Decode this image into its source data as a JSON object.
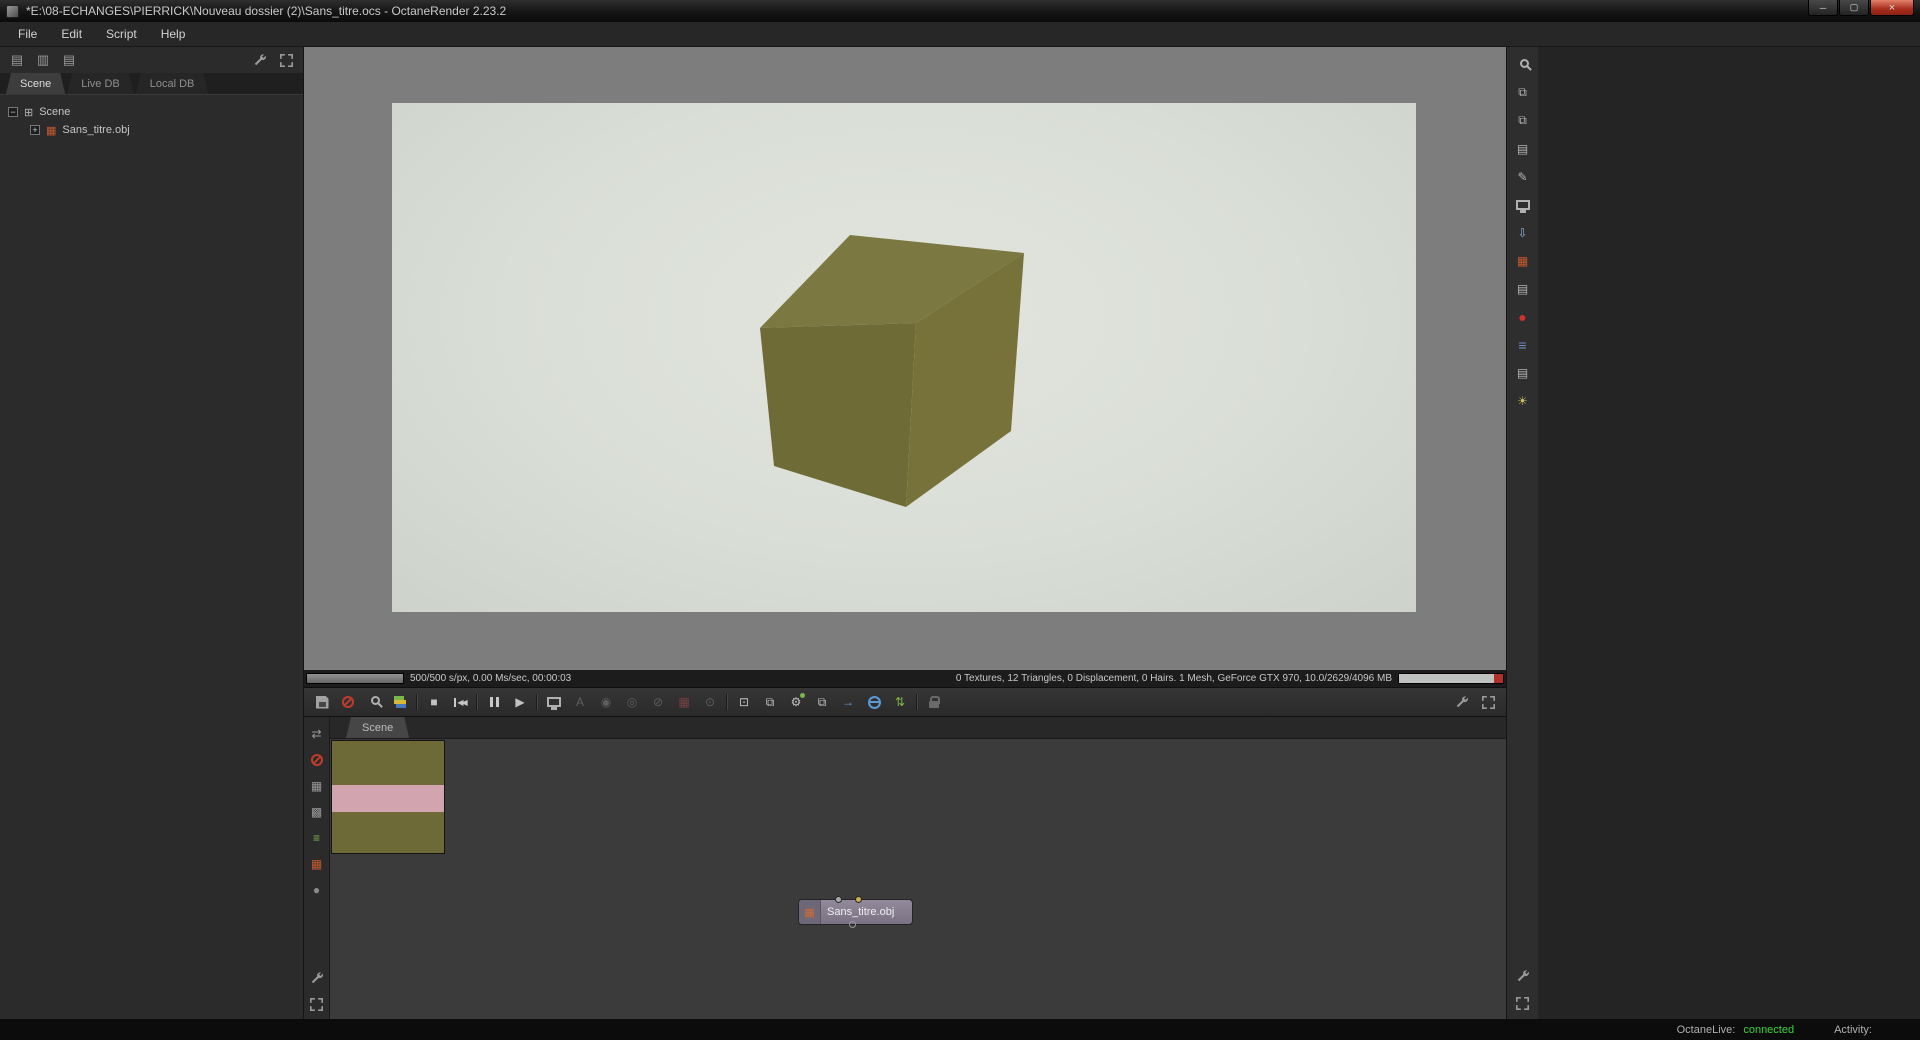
{
  "window": {
    "title": "*E:\\08-ECHANGES\\PIERRICK\\Nouveau dossier (2)\\Sans_titre.ocs - OctaneRender 2.23.2"
  },
  "menu": {
    "items": [
      {
        "label": "File"
      },
      {
        "label": "Edit"
      },
      {
        "label": "Script"
      },
      {
        "label": "Help"
      }
    ]
  },
  "outliner": {
    "tabs": [
      {
        "label": "Scene",
        "active": true
      },
      {
        "label": "Live DB",
        "active": false
      },
      {
        "label": "Local DB",
        "active": false
      }
    ],
    "tree": [
      {
        "label": "Scene",
        "toggle": "−"
      },
      {
        "label": "Sans_titre.obj",
        "toggle": "+"
      }
    ]
  },
  "render_status": {
    "progress_text": "500/500 s/px, 0.00 Ms/sec, 00:00:03",
    "stats_text": "0 Textures, 12 Triangles, 0 Displacement, 0 Hairs. 1 Mesh, GeForce GTX 970, 10.0/2629/4096 MB"
  },
  "nodegraph": {
    "tab_label": "Scene",
    "node_label": "Sans_titre.obj",
    "node_pins": [
      {
        "color": "#a8a8a8"
      },
      {
        "color": "#c8b050"
      },
      {
        "color": "outline"
      }
    ]
  },
  "statusbar": {
    "live_label": "OctaneLive:",
    "live_value": "connected",
    "live_style": "color:#35d435",
    "activity_label": "Activity:"
  },
  "colors": {
    "cube_top": "#7c7841",
    "cube_left": "#6f6b37",
    "cube_right": "#767239",
    "render_bg": "#dce0d8",
    "preview_olive": "#6e6a38",
    "preview_pink": "#d2a4b0",
    "node_body": "#8b8290",
    "accent_red": "#c23b2e",
    "connected_green": "#35d435"
  },
  "glyphs": {
    "minimize": "─",
    "maximize": "▢",
    "close": "×",
    "panel_a": "▤",
    "panel_b": "▥",
    "panel_c": "▤",
    "scene_node": "⊞",
    "mesh": "▦",
    "stop": "■",
    "play": "▶",
    "rewind": "◀◀",
    "letter_a": "A",
    "circle_a": "◉",
    "circle_b": "◎",
    "circle_c": "⊘",
    "circle_d": "⊙",
    "grid_red": "▦",
    "region": "⊡",
    "copy": "⧉",
    "gear": "⚙",
    "arrow": "→",
    "updown": "⇅",
    "pan": "⇄",
    "dots_a": "▦",
    "dots_b": "▩",
    "list": "≡",
    "sphere": "●",
    "file_a": "⧉",
    "file_b": "⧉",
    "image": "▤",
    "pencil": "✎",
    "down": "⇩",
    "ball": "●",
    "stack": "≡",
    "sun": "☀"
  }
}
